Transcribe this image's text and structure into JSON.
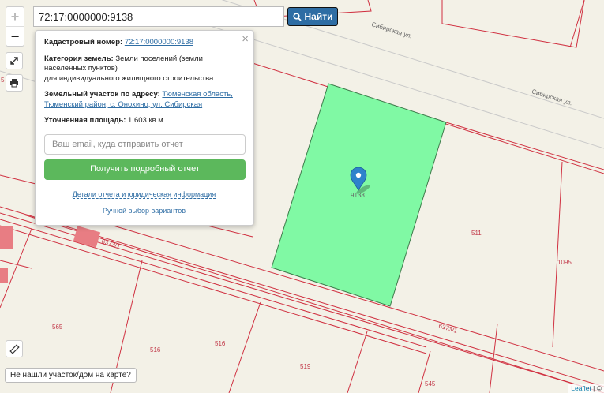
{
  "search": {
    "value": "72:17:0000000:9138",
    "button_label": "Найти"
  },
  "zoom": {
    "in_label": "+",
    "out_label": "−"
  },
  "popup": {
    "close_label": "×",
    "cadastral_label": "Кадастровый номер:",
    "cadastral_value": "72:17:0000000:9138",
    "category_label": "Категория земель:",
    "category_line1": "Земли поселений (земли",
    "category_line2": "населенных пунктов)",
    "category_line3": "для индивидуального жилищного строительства",
    "address_label": "Земельный участок по адресу:",
    "address_line1": "Тюменская область,",
    "address_line2": "Тюменский район, с. Онохино, ул. Сибирская",
    "area_label": "Уточненная площадь:",
    "area_value": "1 603 кв.м.",
    "email_placeholder": "Ваш email, куда отправить отчет",
    "report_button": "Получить подробный отчет",
    "details_link": "Детали отчета и юридическая информация",
    "manual_link": "Ручной выбор вариантов"
  },
  "map": {
    "marker_label": "9138",
    "parcel_labels": {
      "p511": "511",
      "p1095": "1095",
      "p565": "565",
      "p516a": "516",
      "p516b": "516",
      "p519": "519",
      "p545": "545",
      "p5": "5"
    },
    "road_labels": {
      "road_a": "6373/1",
      "road_b": "6373/1"
    },
    "street_labels": {
      "street_a": "Сибирская ул.",
      "street_b": "Сибирская ул."
    },
    "colors": {
      "parcel_fill": "#80f9a4",
      "boundary": "#d03040",
      "building": "#e87d83"
    }
  },
  "not_found": "Не нашли участок/дом на карте?",
  "attribution": {
    "leaflet": "Leaflet",
    "rest": " | ©"
  }
}
